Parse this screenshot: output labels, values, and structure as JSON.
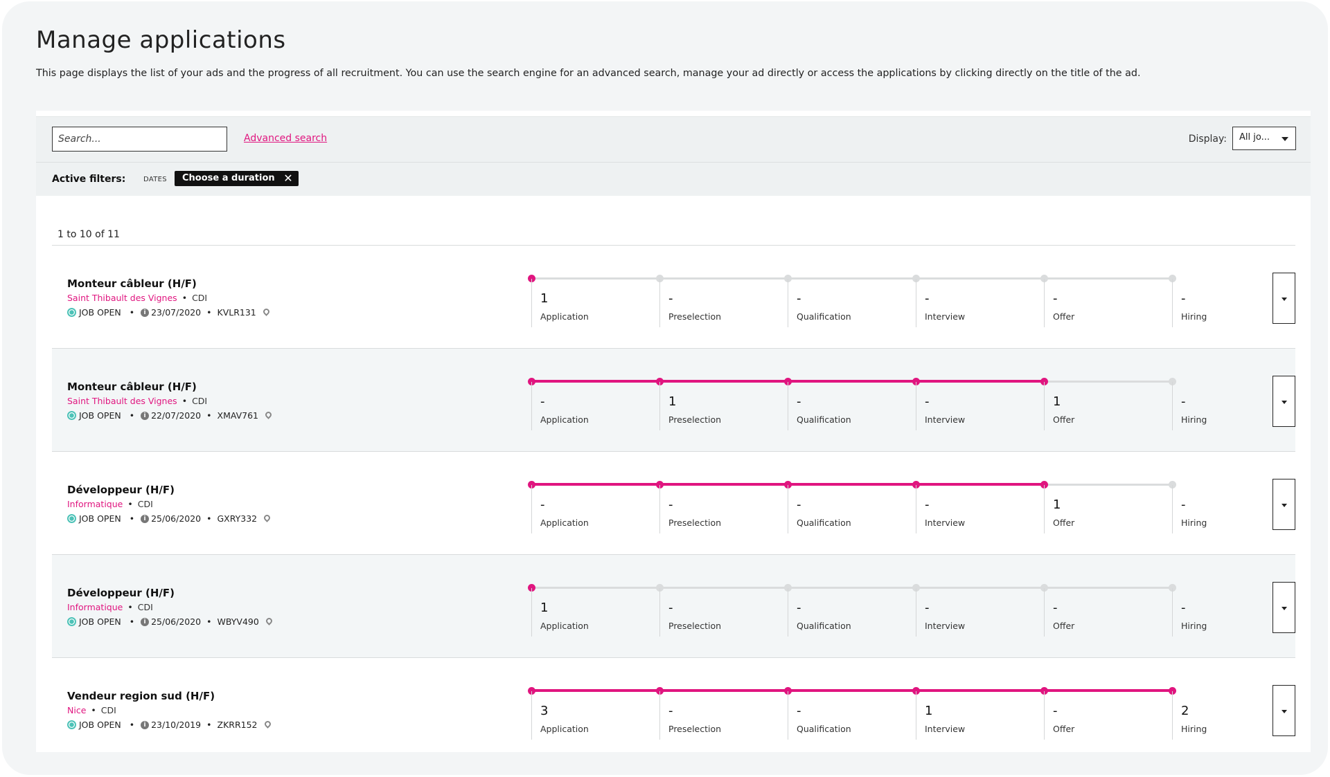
{
  "page": {
    "title": "Manage applications",
    "description": "This page displays the list of your ads and the progress of all recruitment. You can use the search engine for an advanced search, manage your ad directly or access the applications by clicking directly on the title of the ad."
  },
  "search": {
    "placeholder": "Search...",
    "advanced_link": "Advanced search",
    "display_label": "Display:",
    "display_value": "All jo..."
  },
  "filters": {
    "label": "Active filters:",
    "category": "DATES",
    "chip": "Choose a duration",
    "chip_close": "✕"
  },
  "results_count": "1 to 10 of 11",
  "stage_labels": [
    "Application",
    "Preselection",
    "Qualification",
    "Interview",
    "Offer",
    "Hiring"
  ],
  "colors": {
    "accent": "#e0157f",
    "status_open": "#4cc2b7",
    "inactive_track": "#dadcdd"
  },
  "jobs": [
    {
      "title": "Monteur câbleur (H/F)",
      "location": "Saint Thibault des Vignes",
      "contract": "CDI",
      "status": "JOB OPEN",
      "date": "23/07/2020",
      "ref": "KVLR131",
      "progress_stage": 0,
      "stages": [
        "1",
        "-",
        "-",
        "-",
        "-",
        "-"
      ]
    },
    {
      "title": "Monteur câbleur (H/F)",
      "location": "Saint Thibault des Vignes",
      "contract": "CDI",
      "status": "JOB OPEN",
      "date": "22/07/2020",
      "ref": "XMAV761",
      "progress_stage": 4,
      "stages": [
        "-",
        "1",
        "-",
        "-",
        "1",
        "-"
      ]
    },
    {
      "title": "Développeur (H/F)",
      "location": "Informatique",
      "contract": "CDI",
      "status": "JOB OPEN",
      "date": "25/06/2020",
      "ref": "GXRY332",
      "progress_stage": 4,
      "stages": [
        "-",
        "-",
        "-",
        "-",
        "1",
        "-"
      ]
    },
    {
      "title": "Développeur (H/F)",
      "location": "Informatique",
      "contract": "CDI",
      "status": "JOB OPEN",
      "date": "25/06/2020",
      "ref": "WBYV490",
      "progress_stage": 0,
      "stages": [
        "1",
        "-",
        "-",
        "-",
        "-",
        "-"
      ]
    },
    {
      "title": "Vendeur region sud (H/F)",
      "location": "Nice",
      "contract": "CDI",
      "status": "JOB OPEN",
      "date": "23/10/2019",
      "ref": "ZKRR152",
      "progress_stage": 5,
      "stages": [
        "3",
        "-",
        "-",
        "1",
        "-",
        "2"
      ]
    }
  ]
}
